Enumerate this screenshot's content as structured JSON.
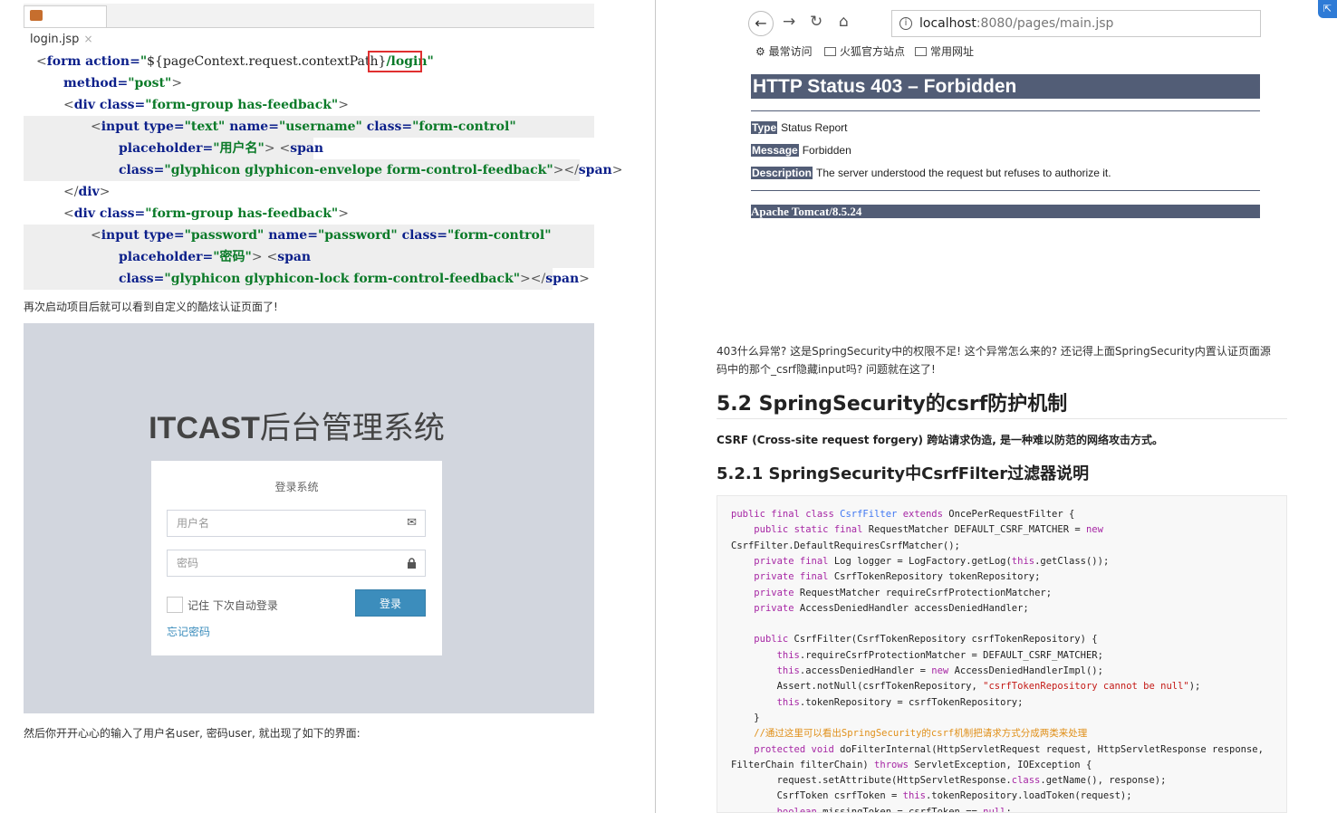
{
  "left": {
    "tab": {
      "filename": "login.jsp",
      "close": "×"
    },
    "code_lines": [
      "<form action=\"${pageContext.request.contextPath}/login\"",
      "method=\"post\">",
      "<div class=\"form-group has-feedback\">",
      "<input type=\"text\" name=\"username\" class=\"form-control\"",
      "placeholder=\"用户名\"> <span",
      "class=\"glyphicon glyphicon-envelope form-control-feedback\"></span>",
      "</div>",
      "<div class=\"form-group has-feedback\">",
      "<input type=\"password\" name=\"password\" class=\"form-control\"",
      "placeholder=\"密码\"> <span",
      "class=\"glyphicon glyphicon-lock form-control-feedback\"></span>"
    ],
    "para1": "再次启动项目后就可以看到自定义的酷炫认证页面了!",
    "login_page": {
      "title_bold": "ITCAST",
      "title_rest": "后台管理系统",
      "subtitle": "登录系统",
      "username_placeholder": "用户名",
      "password_placeholder": "密码",
      "remember": "记住 下次自动登录",
      "login_button": "登录",
      "forgot": "忘记密码"
    },
    "para2": "然后你开开心心的输入了用户名user, 密码user, 就出现了如下的界面:"
  },
  "right": {
    "browser": {
      "url_host": "localhost",
      "url_path": ":8080/pages/main.jsp",
      "bookmarks": [
        "最常访问",
        "火狐官方站点",
        "常用网址"
      ]
    },
    "error": {
      "title": "HTTP Status 403 – Forbidden",
      "type_key": "Type",
      "type_val": "Status Report",
      "message_key": "Message",
      "message_val": "Forbidden",
      "desc_key": "Description",
      "desc_val": "The server understood the request but refuses to authorize it.",
      "footer": "Apache Tomcat/8.5.24"
    },
    "para_line1": "403什么异常? 这是SpringSecurity中的权限不足! 这个异常怎么来的? 还记得上面SpringSecurity内置认证页面源",
    "para_line2": "码中的那个_csrf隐藏input吗? 问题就在这了!",
    "h2": "5.2 SpringSecurity的csrf防护机制",
    "csrf_def": "CSRF (Cross-site request forgery) 跨站请求伪造, 是一种难以防范的网络攻击方式。",
    "h3": "5.2.1 SpringSecurity中CsrfFilter过滤器说明",
    "code_lines": [
      "public final class CsrfFilter extends OncePerRequestFilter {",
      "    public static final RequestMatcher DEFAULT_CSRF_MATCHER = new",
      "CsrfFilter.DefaultRequiresCsrfMatcher();",
      "    private final Log logger = LogFactory.getLog(this.getClass());",
      "    private final CsrfTokenRepository tokenRepository;",
      "    private RequestMatcher requireCsrfProtectionMatcher;",
      "    private AccessDeniedHandler accessDeniedHandler;",
      "",
      "    public CsrfFilter(CsrfTokenRepository csrfTokenRepository) {",
      "        this.requireCsrfProtectionMatcher = DEFAULT_CSRF_MATCHER;",
      "        this.accessDeniedHandler = new AccessDeniedHandlerImpl();",
      "        Assert.notNull(csrfTokenRepository, \"csrfTokenRepository cannot be null\");",
      "        this.tokenRepository = csrfTokenRepository;",
      "    }",
      "    //通过这里可以看出SpringSecurity的csrf机制把请求方式分成两类来处理",
      "    protected void doFilterInternal(HttpServletRequest request, HttpServletResponse response,",
      "FilterChain filterChain) throws ServletException, IOException {",
      "        request.setAttribute(HttpServletResponse.class.getName(), response);",
      "        CsrfToken csrfToken = this.tokenRepository.loadToken(request);",
      "        boolean missingToken = csrfToken == null;"
    ]
  },
  "colors": {
    "tomcat": "#525d76",
    "adminlte_blue": "#3c8dbc",
    "panel_bg": "#d2d6de"
  }
}
